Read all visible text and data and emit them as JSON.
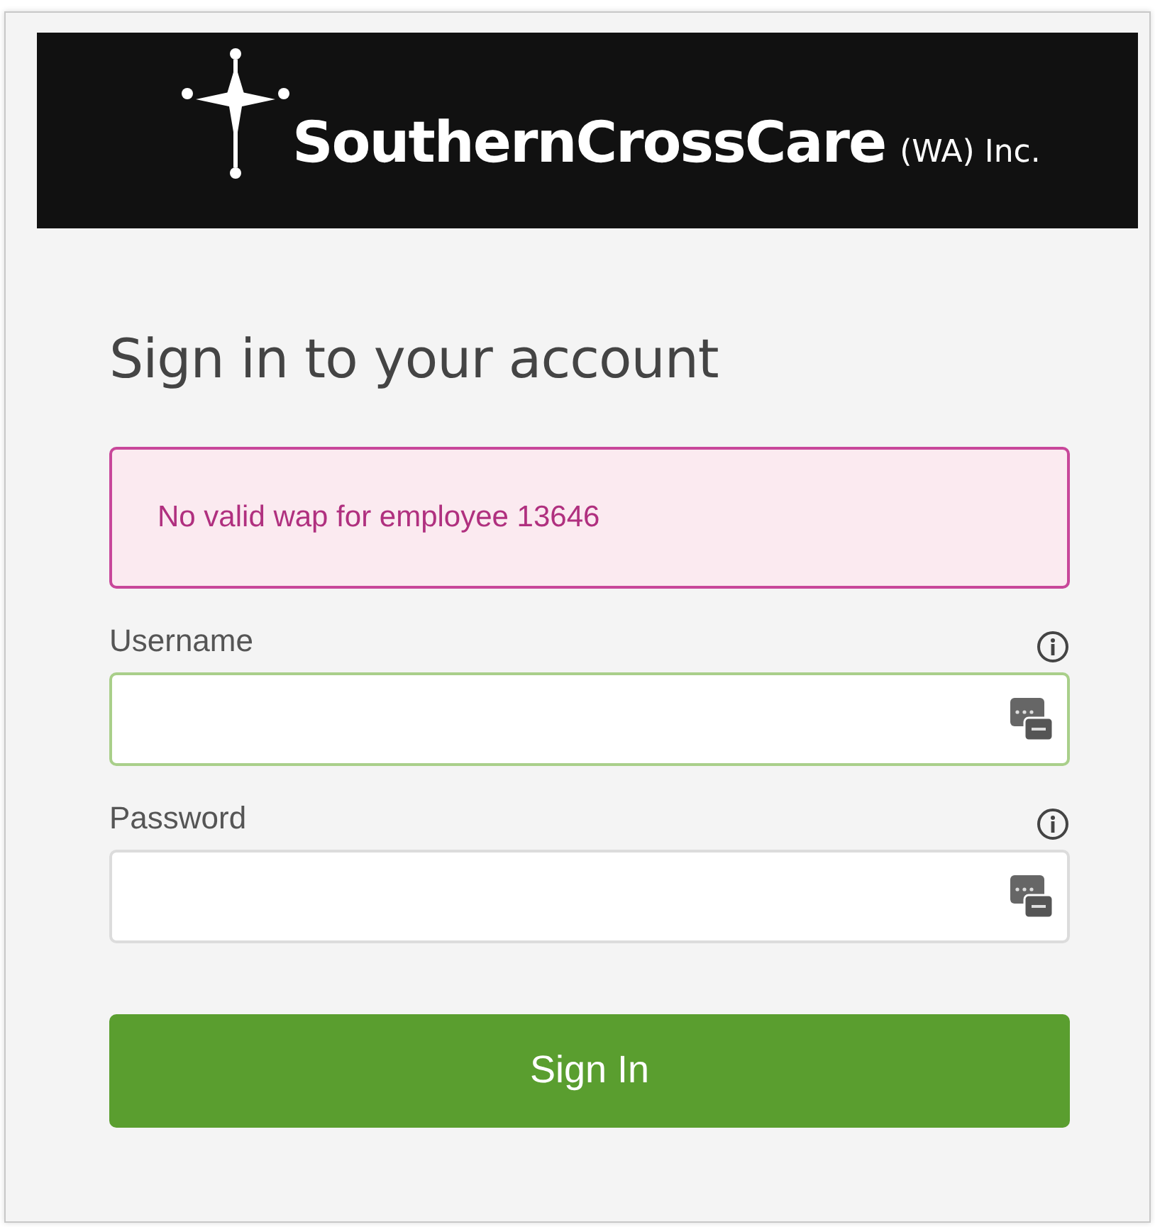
{
  "header": {
    "logo_name": "SouthernCrossCare",
    "logo_suffix": "(WA) Inc."
  },
  "heading": "Sign in to your account",
  "alert": "No valid wap for employee 13646",
  "fields": [
    {
      "label": "Username",
      "focused": true
    },
    {
      "label": "Password",
      "focused": false
    }
  ],
  "submit": "Sign In"
}
